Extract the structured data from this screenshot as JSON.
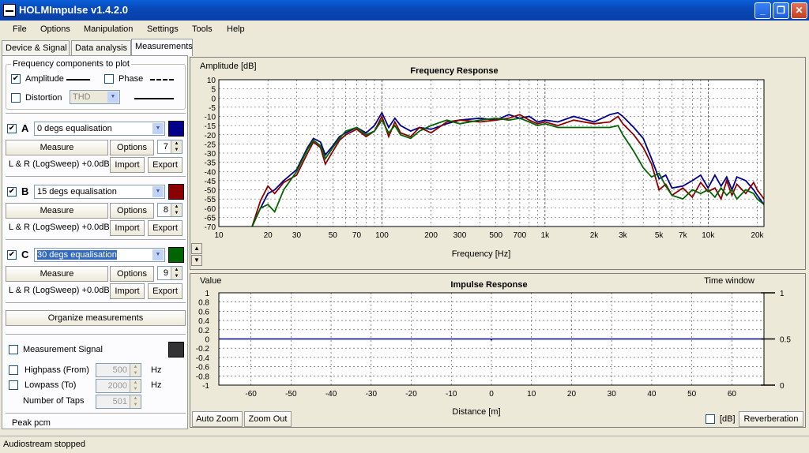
{
  "window": {
    "title": "HOLMImpulse  v1.4.2.0",
    "minimize": "_",
    "maximize": "❐",
    "close": "✕"
  },
  "menu": [
    "File",
    "Options",
    "Manipulation",
    "Settings",
    "Tools",
    "Help"
  ],
  "tabs": [
    "Device & Signal",
    "Data analysis",
    "Measurements"
  ],
  "freq_components": {
    "title": "Frequency components to plot",
    "amplitude": {
      "label": "Amplitude",
      "checked": true
    },
    "phase": {
      "label": "Phase",
      "checked": false
    },
    "distortion": {
      "label": "Distortion",
      "checked": false,
      "type": "THD"
    }
  },
  "measurements": [
    {
      "letter": "A",
      "checked": true,
      "name": "0 degs  equalisation",
      "color": "#00008b",
      "measure": "Measure",
      "options": "Options",
      "count": "7",
      "info": "L & R (LogSweep) +0.0dB",
      "import": "Import",
      "export": "Export"
    },
    {
      "letter": "B",
      "checked": true,
      "name": "15 degs equalisation",
      "color": "#8b0000",
      "measure": "Measure",
      "options": "Options",
      "count": "8",
      "info": "L & R (LogSweep) +0.0dB",
      "import": "Import",
      "export": "Export"
    },
    {
      "letter": "C",
      "checked": true,
      "name": "30 degs equalisation",
      "color": "#006400",
      "measure": "Measure",
      "options": "Options",
      "count": "9",
      "info": "L & R (LogSweep) +0.0dB",
      "import": "Import",
      "export": "Export"
    }
  ],
  "organize_label": "Organize measurements",
  "signal": {
    "measurement_signal": "Measurement Signal",
    "highpass": {
      "label": "Highpass (From)",
      "value": "500",
      "unit": "Hz"
    },
    "lowpass": {
      "label": "Lowpass (To)",
      "value": "2000",
      "unit": "Hz"
    },
    "taps": {
      "label": "Number of Taps",
      "value": "501"
    },
    "peak": "Peak pcm"
  },
  "freq_chart": {
    "title": "Frequency Response",
    "ylabel": "Amplitude [dB]",
    "xlabel": "Frequency [Hz]",
    "yticks": [
      "10",
      "5",
      "0",
      "-5",
      "-10",
      "-15",
      "-20",
      "-25",
      "-30",
      "-35",
      "-40",
      "-45",
      "-50",
      "-55",
      "-60",
      "-65",
      "-70"
    ],
    "xticks": [
      "10",
      "20",
      "30",
      "50",
      "70",
      "100",
      "200",
      "300",
      "500",
      "700",
      "1k",
      "2k",
      "3k",
      "5k",
      "7k",
      "10k",
      "20k"
    ]
  },
  "impulse_chart": {
    "title": "Impulse Response",
    "ylabel": "Value",
    "right_label": "Time window",
    "xlabel": "Distance [m]",
    "yticks": [
      "1",
      "0.8",
      "0.6",
      "0.4",
      "0.2",
      "0",
      "-0.2",
      "-0.4",
      "-0.6",
      "-0.8",
      "-1"
    ],
    "xticks": [
      "-60",
      "-50",
      "-40",
      "-30",
      "-20",
      "-10",
      "0",
      "10",
      "20",
      "30",
      "40",
      "50",
      "60"
    ],
    "rticks": [
      "1",
      "0.5",
      "0"
    ]
  },
  "bottom": {
    "auto_zoom": "Auto Zoom",
    "zoom_out": "Zoom Out",
    "db": "[dB]",
    "reverb": "Reverberation"
  },
  "status": "Audiostream stopped",
  "chart_data": [
    {
      "type": "line",
      "title": "Frequency Response",
      "xlabel": "Frequency [Hz]",
      "ylabel": "Amplitude [dB]",
      "xscale": "log",
      "xlim": [
        10,
        22000
      ],
      "ylim": [
        -70,
        10
      ],
      "grid": true,
      "series": [
        {
          "name": "0 degs  equalisation",
          "color": "#00008b",
          "x": [
            16,
            18,
            20,
            22,
            25,
            30,
            35,
            38,
            42,
            45,
            50,
            55,
            60,
            70,
            80,
            90,
            100,
            110,
            120,
            130,
            150,
            170,
            200,
            250,
            300,
            400,
            500,
            600,
            700,
            800,
            900,
            1000,
            1200,
            1500,
            2000,
            2500,
            2800,
            3000,
            3500,
            4000,
            4500,
            5000,
            5500,
            6000,
            7000,
            8000,
            9000,
            10000,
            11000,
            12000,
            13000,
            14000,
            15000,
            17000,
            19000,
            20000,
            22000
          ],
          "y": [
            -70,
            -60,
            -52,
            -50,
            -45,
            -39,
            -27,
            -22,
            -24,
            -31,
            -26,
            -21,
            -19,
            -16,
            -19,
            -15,
            -8,
            -16,
            -11,
            -15,
            -18,
            -16,
            -17,
            -14,
            -12,
            -11,
            -12,
            -9,
            -11,
            -10,
            -13,
            -12,
            -13,
            -10,
            -13,
            -9,
            -8,
            -10,
            -16,
            -22,
            -33,
            -44,
            -42,
            -49,
            -48,
            -45,
            -42,
            -49,
            -42,
            -48,
            -43,
            -50,
            -43,
            -45,
            -50,
            -53,
            -58
          ]
        },
        {
          "name": "15 degs equalisation",
          "color": "#8b0000",
          "x": [
            16,
            18,
            20,
            22,
            25,
            30,
            35,
            38,
            42,
            45,
            50,
            55,
            60,
            70,
            80,
            90,
            100,
            110,
            120,
            130,
            150,
            170,
            200,
            250,
            300,
            400,
            500,
            600,
            700,
            800,
            900,
            1000,
            1200,
            1500,
            2000,
            2500,
            2800,
            3000,
            3500,
            4000,
            4500,
            5000,
            5500,
            6000,
            7000,
            8000,
            9000,
            10000,
            11000,
            12000,
            13000,
            14000,
            15000,
            17000,
            19000,
            20000,
            22000
          ],
          "y": [
            -70,
            -56,
            -48,
            -52,
            -46,
            -42,
            -30,
            -24,
            -27,
            -36,
            -29,
            -23,
            -20,
            -17,
            -21,
            -18,
            -10,
            -21,
            -13,
            -19,
            -21,
            -16,
            -19,
            -13,
            -12,
            -13,
            -12,
            -11,
            -9,
            -12,
            -14,
            -13,
            -15,
            -12,
            -14,
            -13,
            -10,
            -14,
            -20,
            -27,
            -36,
            -50,
            -47,
            -53,
            -49,
            -54,
            -46,
            -51,
            -49,
            -55,
            -45,
            -53,
            -47,
            -52,
            -46,
            -50,
            -55
          ]
        },
        {
          "name": "30 degs equalisation",
          "color": "#006400",
          "x": [
            16,
            18,
            20,
            22,
            25,
            30,
            35,
            38,
            42,
            45,
            50,
            55,
            60,
            70,
            80,
            90,
            100,
            110,
            120,
            130,
            150,
            170,
            200,
            250,
            300,
            400,
            500,
            600,
            700,
            800,
            900,
            1000,
            1200,
            1500,
            2000,
            2500,
            2800,
            3000,
            3500,
            4000,
            4500,
            5000,
            5500,
            6000,
            7000,
            8000,
            9000,
            10000,
            11000,
            12000,
            13000,
            14000,
            15000,
            17000,
            19000,
            20000,
            22000
          ],
          "y": [
            -70,
            -60,
            -58,
            -62,
            -50,
            -40,
            -28,
            -23,
            -26,
            -33,
            -27,
            -22,
            -18,
            -16,
            -20,
            -18,
            -12,
            -19,
            -15,
            -20,
            -22,
            -18,
            -15,
            -12,
            -14,
            -12,
            -11,
            -12,
            -11,
            -13,
            -15,
            -14,
            -16,
            -16,
            -16,
            -16,
            -15,
            -20,
            -29,
            -38,
            -43,
            -41,
            -48,
            -53,
            -55,
            -50,
            -52,
            -50,
            -54,
            -49,
            -53,
            -50,
            -55,
            -50,
            -52,
            -55,
            -58
          ]
        }
      ]
    },
    {
      "type": "line",
      "title": "Impulse Response",
      "xlabel": "Distance [m]",
      "ylabel": "Value",
      "xlim": [
        -68,
        68
      ],
      "ylim": [
        -1,
        1
      ],
      "grid": true,
      "series": [
        {
          "name": "",
          "color": "#00008b",
          "x": [
            -68,
            -0.2,
            0,
            0.2,
            68
          ],
          "y": [
            0,
            0,
            -0.02,
            0,
            0
          ]
        }
      ]
    }
  ]
}
